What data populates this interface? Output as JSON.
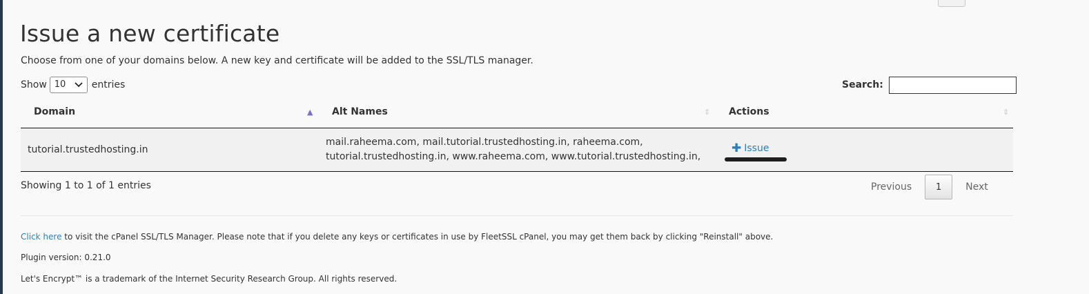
{
  "header": {
    "title": "Issue a new certificate",
    "intro": "Choose from one of your domains below. A new key and certificate will be added to the SSL/TLS manager."
  },
  "controls": {
    "show_label": "Show",
    "entries_value": "10",
    "entries_label": "entries",
    "search_label": "Search:",
    "search_value": ""
  },
  "table": {
    "columns": [
      "Domain",
      "Alt Names",
      "Actions"
    ],
    "rows": [
      {
        "domain": "tutorial.trustedhosting.in",
        "alt_line1": "mail.raheema.com, mail.tutorial.trustedhosting.in, raheema.com,",
        "alt_line2": "tutorial.trustedhosting.in, www.raheema.com, www.tutorial.trustedhosting.in,",
        "action_label": "Issue"
      }
    ]
  },
  "pagination": {
    "info": "Showing 1 to 1 of 1 entries",
    "previous": "Previous",
    "current_page": "1",
    "next": "Next"
  },
  "footer": {
    "link_text": "Click here",
    "line1_rest": " to visit the cPanel SSL/TLS Manager. Please note that if you delete any keys or certificates in use by FleetSSL cPanel, you may get them back by clicking \"Reinstall\" above.",
    "plugin_version": "Plugin version: 0.21.0",
    "trademark": "Let's Encrypt™ is a trademark of the Internet Security Research Group. All rights reserved."
  },
  "colors": {
    "link": "#2e7dbf",
    "sort_active": "#7a6fd8",
    "left_rail": "#293a4a"
  },
  "icons": [
    "sort-asc-icon",
    "sort-both-icon",
    "plus-icon",
    "chevron-down-icon"
  ]
}
